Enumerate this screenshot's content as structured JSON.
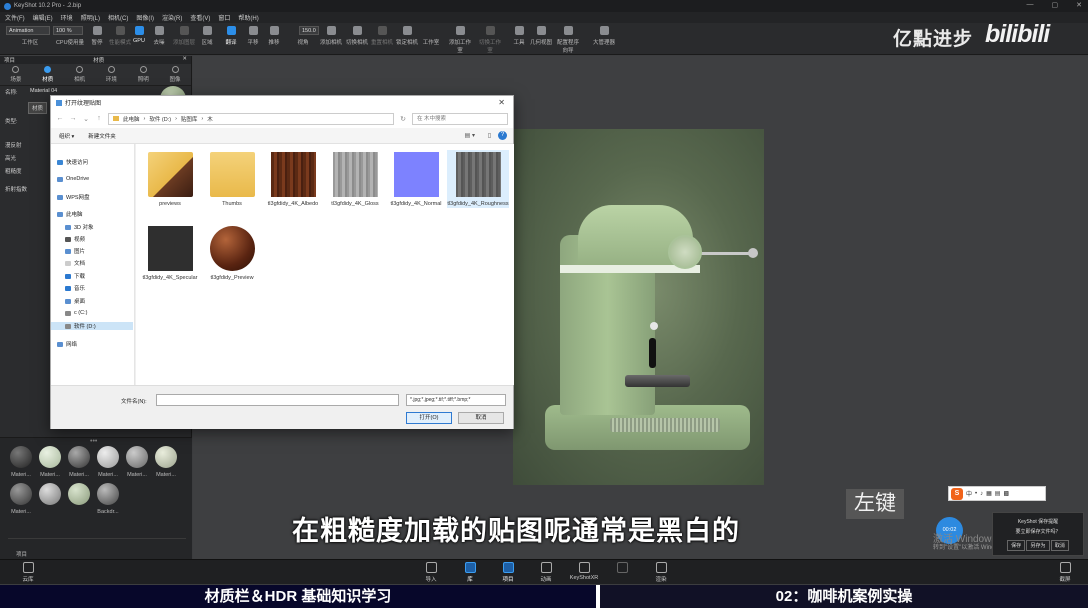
{
  "window": {
    "title": "KeyShot 10.2 Pro - .2.bip",
    "controls": [
      "—",
      "▢",
      "✕"
    ]
  },
  "menu": [
    "文件(F)",
    "编辑(E)",
    "环境",
    "照明(L)",
    "相机(C)",
    "图像(I)",
    "渲染(R)",
    "查看(V)",
    "窗口",
    "帮助(H)"
  ],
  "toolbar": {
    "workspace_value": "Animation",
    "zoom_value": "100 %",
    "fov_value": "150.0",
    "buttons": [
      "工作区",
      "CPU使用量",
      "暂停",
      "性能模式",
      "GPU",
      "去噪",
      "添加图层",
      "区域",
      "翻译",
      "平移",
      "推移",
      "视角",
      "添加相机",
      "切换相机",
      "重置相机",
      "锁定相机",
      "工作室",
      "添加工作室",
      "切换工作室",
      "工具",
      "几何视图",
      "配置程序向导",
      "大管理器"
    ]
  },
  "watermark": {
    "brand": "亿點进步",
    "site": "bilibili"
  },
  "left_panel": {
    "header_left": "项目",
    "header_center": "材质",
    "tabs": [
      "场景",
      "材质",
      "相机",
      "环境",
      "照明",
      "图像"
    ],
    "name_label": "名称:",
    "name_value": "Material 04",
    "type_label": "类型:",
    "type_button": "材质",
    "props": [
      "漫反射",
      "高光",
      "粗糙度",
      "折射指数"
    ],
    "lib_footer": "项目",
    "library": [
      "Materi...",
      "Materi...",
      "Materi...",
      "Materi...",
      "Materi...",
      "Materi...",
      "Materi...",
      "Backdr..."
    ]
  },
  "dialog": {
    "title": "打开纹理贴图",
    "path": [
      "此电脑",
      "软件 (D:)",
      "贴图库",
      "木"
    ],
    "search_placeholder": "在 木中搜索",
    "organize": "组织 ▾",
    "new_folder": "新建文件夹",
    "nav": [
      "快速访问",
      "OneDrive",
      "WPS网盘",
      "此电脑",
      "3D 对象",
      "视频",
      "图片",
      "文档",
      "下载",
      "音乐",
      "桌面",
      "c (C:)",
      "软件 (D:)",
      "网络"
    ],
    "files": [
      "previews",
      "Thumbs",
      "tl3gfdidy_4K_Albedo",
      "tl3gfdidy_4K_Gloss",
      "tl3gfdidy_4K_Normal",
      "tl3gfdidy_4K_Roughness",
      "tl3gfdidy_4K_Specular",
      "tl3gfdidy_Preview"
    ],
    "filename_label": "文件名(N):",
    "filetype": "*.jpg;*.jpeg;*.tif;*.tiff;*.bmp;*",
    "open": "打开(O)",
    "cancel": "取消"
  },
  "caption": "在粗糙度加载的贴图呢通常是黑白的",
  "left_key": "左键",
  "ime": {
    "logo": "S",
    "lang": "中"
  },
  "clock_bubble": "00:02",
  "activate_windows": [
    "激活 Windows",
    "转到\"设置\"以激活 Windows。"
  ],
  "save_notice": {
    "title": "KeyShot 保存提醒",
    "text": "要立即保存文件吗？",
    "buttons": [
      "保存",
      "另存为",
      "取消"
    ]
  },
  "bottom_bar": [
    "云库",
    "导入",
    "库",
    "项目",
    "动画",
    "KeyShotXR",
    "渲染",
    "截屏"
  ],
  "course": {
    "left": "材质栏＆HDR 基础知识学习",
    "right": "02：咖啡机案例实操"
  }
}
